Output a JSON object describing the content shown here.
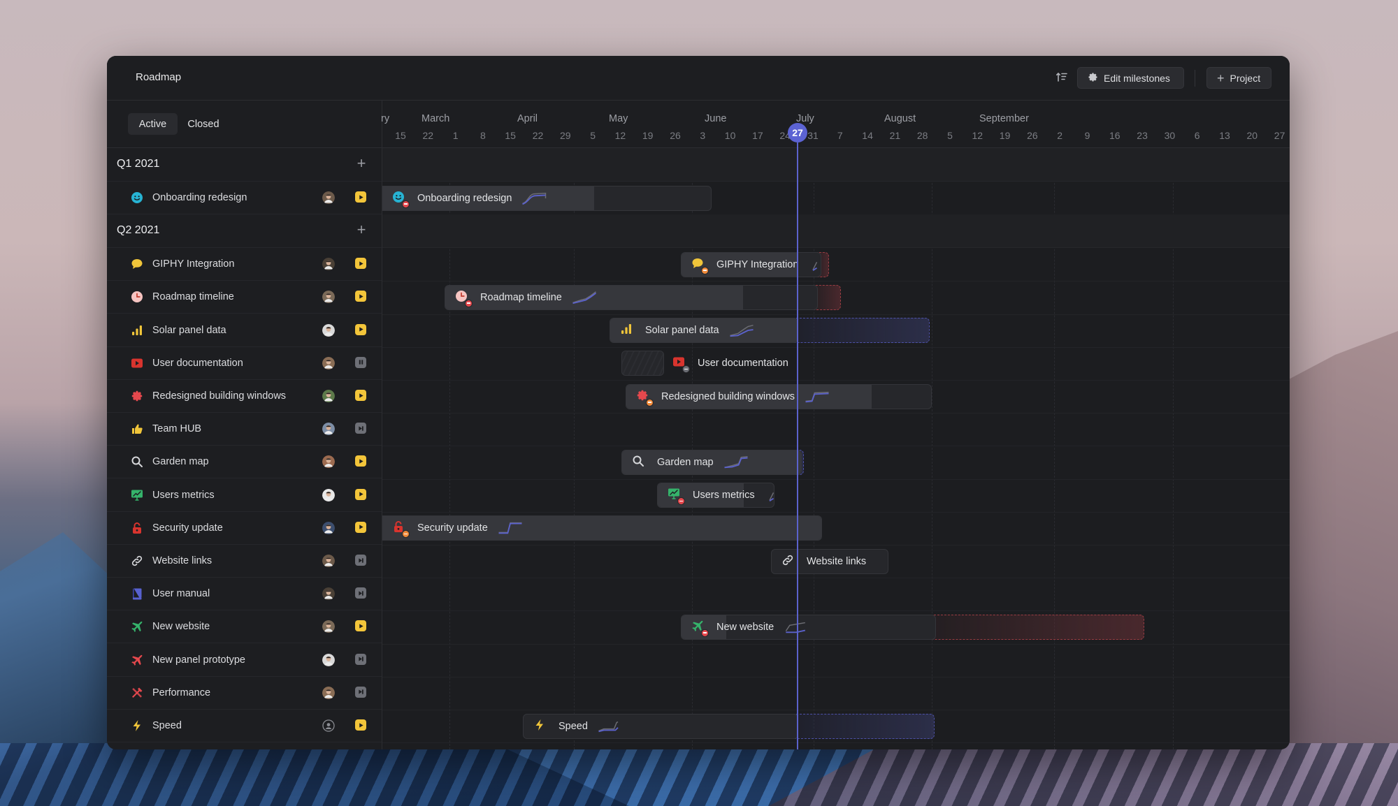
{
  "app": {
    "title": "Roadmap",
    "toolbar": {
      "sort_icon": "sort-icon",
      "edit_milestones_label": "Edit milestones",
      "edit_milestones_icon": "gear-icon",
      "add_project_label": "Project",
      "add_project_icon": "plus-icon"
    }
  },
  "tabs": [
    {
      "label": "Active",
      "selected": true
    },
    {
      "label": "Closed",
      "selected": false
    }
  ],
  "timeline": {
    "months": [
      "ry",
      "March",
      "April",
      "May",
      "June",
      "July",
      "August",
      "September"
    ],
    "days": [
      "15",
      "22",
      "1",
      "8",
      "15",
      "22",
      "29",
      "5",
      "12",
      "19",
      "26",
      "3",
      "10",
      "17",
      "24",
      "31",
      "7",
      "14",
      "21",
      "28",
      "5",
      "12",
      "19",
      "26",
      "2",
      "9",
      "16",
      "23",
      "30",
      "6",
      "13",
      "20",
      "27"
    ],
    "today": "27",
    "colors": {
      "accent": "#5c63d3",
      "status_play": "#f3c53a",
      "status_paused": "#6e7077",
      "overrun_red": "#9a3d43",
      "overrun_blue": "#4d51a8"
    }
  },
  "groups": [
    {
      "label": "Q1 2021",
      "items": [
        {
          "name": "Onboarding redesign",
          "icon": "smiley-icon",
          "icon_color": "#27b3d3",
          "status": "play",
          "bar": {
            "badge": "minus"
          }
        }
      ]
    },
    {
      "label": "Q2 2021",
      "items": [
        {
          "name": "GIPHY Integration",
          "icon": "chat-bubble-icon",
          "icon_color": "#f0c53a",
          "status": "play",
          "bar": {
            "badge": "minus-orange"
          }
        },
        {
          "name": "Roadmap timeline",
          "icon": "clock-icon",
          "icon_color": "#f6c4c1",
          "status": "play",
          "bar": {
            "badge": "minus"
          }
        },
        {
          "name": "Solar panel data",
          "icon": "bar-chart-icon",
          "icon_color": "#f0c53a",
          "status": "play",
          "bar": {
            "badge": "none"
          }
        },
        {
          "name": "User documentation",
          "icon": "video-icon",
          "icon_color": "#d8342e",
          "status": "pause",
          "bar": {
            "badge": "pause"
          }
        },
        {
          "name": "Redesigned building windows",
          "icon": "gear-icon",
          "icon_color": "#e5484d",
          "status": "play",
          "bar": {
            "badge": "clock"
          }
        },
        {
          "name": "Team HUB",
          "icon": "thumbs-up-icon",
          "icon_color": "#f0c53a",
          "status": "skip",
          "bar": null
        },
        {
          "name": "Garden map",
          "icon": "search-icon",
          "icon_color": "#d7d8db",
          "status": "play",
          "bar": {
            "badge": "none"
          }
        },
        {
          "name": "Users metrics",
          "icon": "presentation-chart-icon",
          "icon_color": "#35b36b",
          "status": "play",
          "bar": {
            "badge": "minus"
          }
        },
        {
          "name": "Security update",
          "icon": "lock-icon",
          "icon_color": "#d8342e",
          "status": "play",
          "bar": {
            "badge": "clock"
          }
        },
        {
          "name": "Website links",
          "icon": "link-icon",
          "icon_color": "#d7d8db",
          "status": "skip",
          "bar": {
            "badge": "none"
          }
        },
        {
          "name": "User manual",
          "icon": "book-icon",
          "icon_color": "#5861d0",
          "status": "skip",
          "bar": null
        },
        {
          "name": "New website",
          "icon": "airplane-icon",
          "icon_color": "#35b36b",
          "status": "play",
          "bar": {
            "badge": "minus"
          }
        },
        {
          "name": "New panel prototype",
          "icon": "airplane-icon",
          "icon_color": "#e5484d",
          "status": "skip",
          "bar": null
        },
        {
          "name": "Performance",
          "icon": "tools-icon",
          "icon_color": "#e5484d",
          "status": "skip",
          "bar": null
        },
        {
          "name": "Speed",
          "icon": "lightning-icon",
          "icon_color": "#f0c53a",
          "status": "play",
          "avatar": "placeholder",
          "bar": {
            "badge": "none"
          }
        }
      ]
    }
  ]
}
